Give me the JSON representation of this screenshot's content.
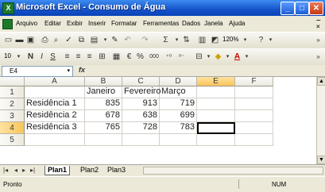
{
  "window": {
    "title": "Microsoft Excel - Consumo de Água"
  },
  "menu": {
    "items": [
      "Arquivo",
      "Editar",
      "Exibir",
      "Inserir",
      "Formatar",
      "Ferramentas",
      "Dados",
      "Janela",
      "Ajuda"
    ]
  },
  "toolbar": {
    "zoom": "120%",
    "font_size": "10",
    "bold": "N",
    "italic": "I",
    "underline": "S",
    "percent": "%",
    "thousands": "000"
  },
  "formula_bar": {
    "cell_ref": "E4",
    "fx": "fx",
    "value": ""
  },
  "grid": {
    "columns": [
      "A",
      "B",
      "C",
      "D",
      "E",
      "F"
    ],
    "rows": [
      "1",
      "2",
      "3",
      "4",
      "5"
    ],
    "cells": [
      [
        "",
        "Janeiro",
        "Fevereiro",
        "Março",
        "",
        ""
      ],
      [
        "Residência 1",
        "835",
        "913",
        "719",
        "",
        ""
      ],
      [
        "Residência 2",
        "678",
        "638",
        "699",
        "",
        ""
      ],
      [
        "Residência 3",
        "765",
        "728",
        "783",
        "",
        ""
      ],
      [
        "",
        "",
        "",
        "",
        "",
        ""
      ]
    ],
    "active_cell": "E4"
  },
  "sheets": [
    "Plan1",
    "Plan2",
    "Plan3"
  ],
  "active_sheet": "Plan1",
  "status": {
    "left": "Pronto",
    "right": "NUM"
  }
}
